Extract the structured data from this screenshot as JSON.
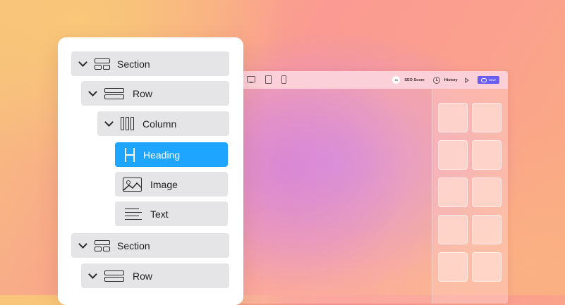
{
  "toolbar": {
    "seo_badge": "91",
    "seo_label": "SEO Score",
    "history_label": "History",
    "save_label": "Save",
    "accent_color": "#6a5df2"
  },
  "navigator": {
    "items": [
      {
        "label": "Section",
        "icon": "section-icon",
        "expanded": true
      },
      {
        "label": "Row",
        "icon": "row-icon",
        "expanded": true
      },
      {
        "label": "Column",
        "icon": "column-icon",
        "expanded": true
      },
      {
        "label": "Heading",
        "icon": "heading-icon",
        "selected": true,
        "selected_color": "#1da5ff"
      },
      {
        "label": "Image",
        "icon": "image-icon"
      },
      {
        "label": "Text",
        "icon": "text-icon"
      },
      {
        "label": "Section",
        "icon": "section-icon",
        "expanded": true
      },
      {
        "label": "Row",
        "icon": "row-icon",
        "expanded": true
      }
    ]
  },
  "widgets_panel": {
    "tile_count": 10
  }
}
